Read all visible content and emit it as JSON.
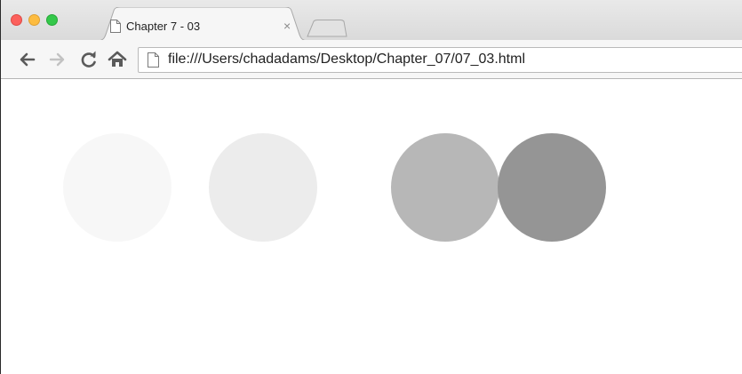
{
  "tab": {
    "title": "Chapter 7 - 03",
    "close_glyph": "×"
  },
  "address_bar": {
    "url": "file:///Users/chadadams/Desktop/Chapter_07/07_03.html"
  },
  "icons": {
    "back": "back-arrow-icon",
    "forward": "forward-arrow-icon",
    "reload": "reload-icon",
    "home": "home-icon",
    "page": "document-icon"
  },
  "page": {
    "circles": [
      {
        "name": "circle-1",
        "color": "#f7f7f7"
      },
      {
        "name": "circle-2",
        "color": "#ececec"
      },
      {
        "name": "circle-3",
        "color": "#b7b7b7"
      },
      {
        "name": "circle-4",
        "color": "#959595"
      }
    ]
  },
  "colors": {
    "traffic_close": "#fc605c",
    "traffic_minimize": "#fdbc40",
    "traffic_zoom": "#34c84a"
  }
}
